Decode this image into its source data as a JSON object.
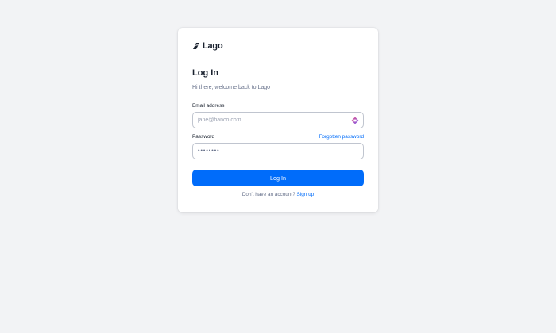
{
  "brand": {
    "name": "Lago",
    "logo_icon": "lago-logo-icon"
  },
  "login": {
    "title": "Log In",
    "subtitle": "Hi there, welcome back to Lago",
    "email": {
      "label": "Email address",
      "placeholder": "jane@banco.com",
      "value": ""
    },
    "password": {
      "label": "Password",
      "forgot_label": "Forgotten password",
      "masked_value": "••••••••",
      "manager_icon": "password-manager-icon"
    },
    "submit_label": "Log In",
    "signup": {
      "prompt": "Don't have an account?",
      "link_label": "Sign up"
    }
  },
  "colors": {
    "background": "#f2f3f5",
    "card": "#ffffff",
    "primary": "#006cfa",
    "text": "#19212e",
    "muted": "#66708a",
    "border": "#c0c5cf"
  }
}
